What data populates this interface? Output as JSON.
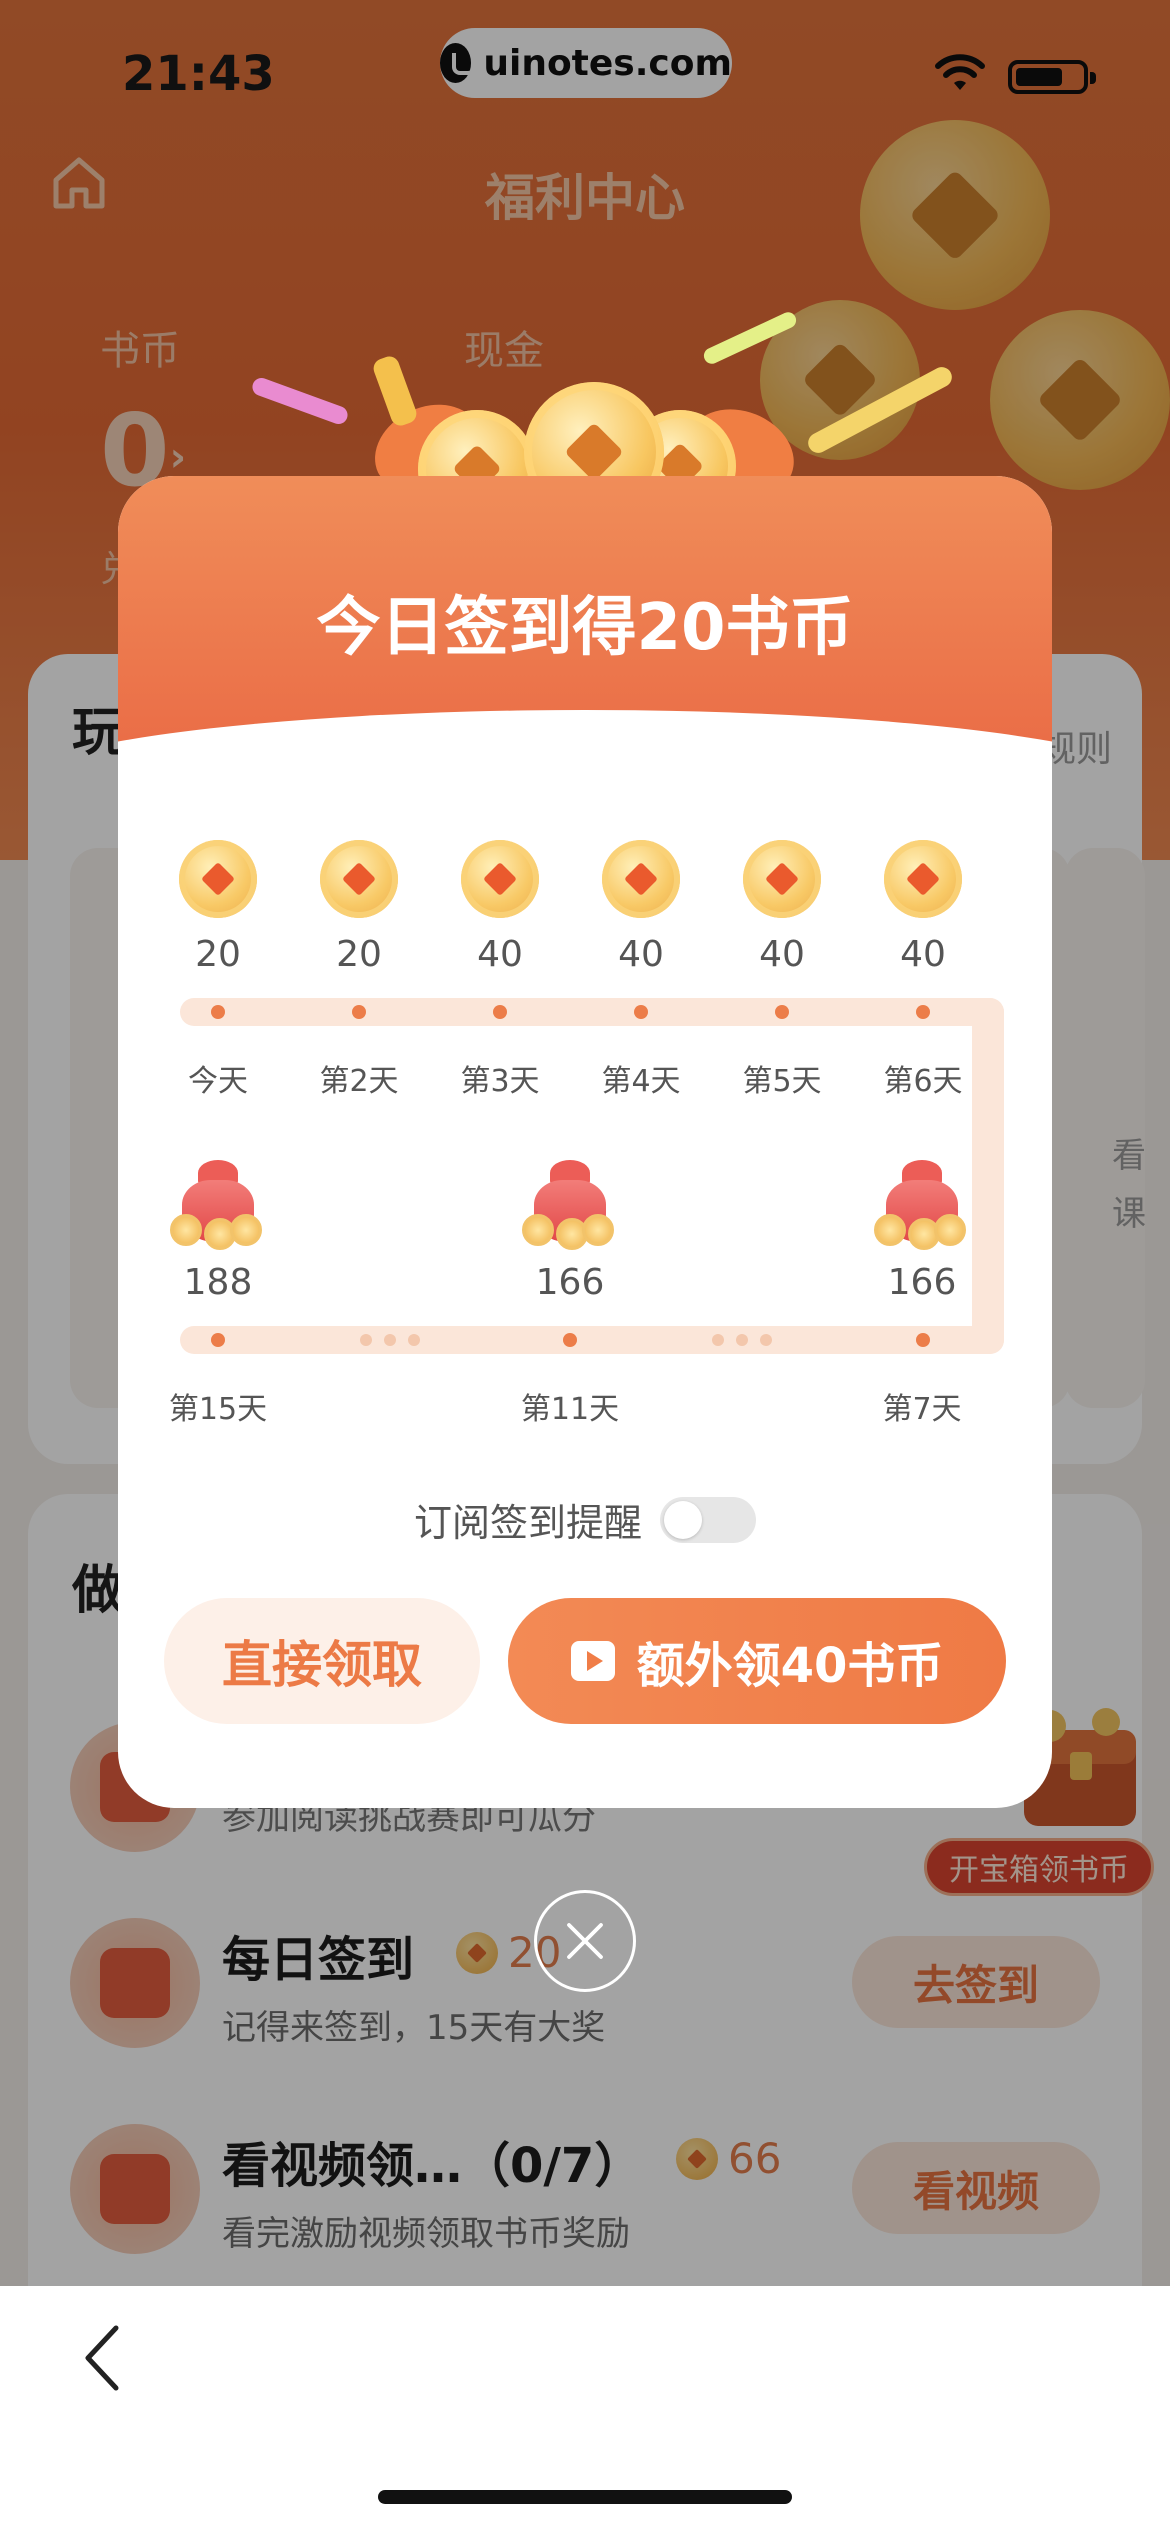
{
  "status_bar": {
    "time": "21:43",
    "url": "uinotes.com"
  },
  "header": {
    "title": "福利中心"
  },
  "balances": {
    "book_coin_label": "书币",
    "cash_label": "现金",
    "book_coin_value": "0",
    "book_coin_arrow": "›",
    "sub_partial": "兑"
  },
  "background": {
    "section_play_partial": "玩",
    "rules_partial": "规则",
    "side_text_1": "看",
    "side_text_2": "课",
    "section_do_partial": "做",
    "task3_sub_partial": "参加阅读挑战赛即可瓜分"
  },
  "tasks": [
    {
      "title": "每日签到",
      "reward": "20",
      "subtitle": "记得来签到，15天有大奖",
      "button": "去签到"
    },
    {
      "title": "看视频领…（0/7）",
      "reward": "66",
      "subtitle": "看完激励视频领取书币奖励",
      "button": "看视频"
    }
  ],
  "treasure": {
    "label": "开宝箱领书币"
  },
  "modal": {
    "title": "今日签到得20书币",
    "row1": [
      {
        "value": "20",
        "label": "今天"
      },
      {
        "value": "20",
        "label": "第2天"
      },
      {
        "value": "40",
        "label": "第3天"
      },
      {
        "value": "40",
        "label": "第4天"
      },
      {
        "value": "40",
        "label": "第5天"
      },
      {
        "value": "40",
        "label": "第6天"
      }
    ],
    "row2": [
      {
        "value": "188",
        "label": "第15天"
      },
      {
        "value": "166",
        "label": "第11天"
      },
      {
        "value": "166",
        "label": "第7天"
      }
    ],
    "remind_label": "订阅签到提醒",
    "remind_on": false,
    "button_direct": "直接领取",
    "button_extra": "额外领40书币"
  },
  "colors": {
    "accent": "#ec7a46",
    "header_bg": "#e46a35"
  },
  "icons": [
    "home-icon",
    "wifi-icon",
    "battery-icon",
    "play-icon",
    "close-icon",
    "back-icon",
    "coin-icon",
    "red-bag-icon",
    "treasure-chest-icon"
  ]
}
